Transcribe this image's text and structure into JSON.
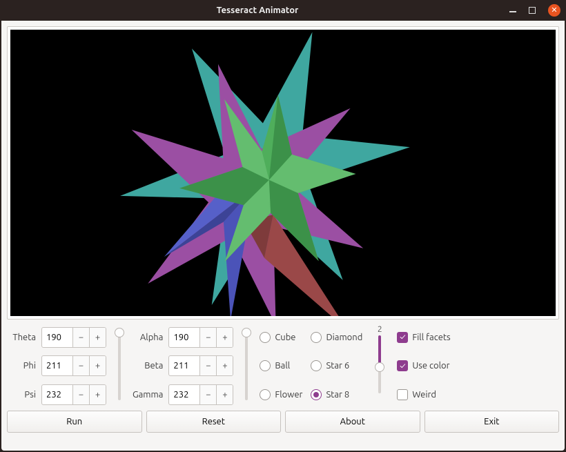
{
  "window": {
    "title": "Tesseract Animator"
  },
  "spinners": {
    "left": [
      {
        "label": "Theta",
        "value": "190"
      },
      {
        "label": "Phi",
        "value": "211"
      },
      {
        "label": "Psi",
        "value": "232"
      }
    ],
    "right": [
      {
        "label": "Alpha",
        "value": "190"
      },
      {
        "label": "Beta",
        "value": "211"
      },
      {
        "label": "Gamma",
        "value": "232"
      }
    ]
  },
  "sliders": {
    "s1": {
      "pos_pct": 2,
      "fill_pct": 2
    },
    "s2": {
      "pos_pct": 2,
      "fill_pct": 2
    },
    "s3": {
      "value": "2",
      "pos_pct": 55,
      "fill_pct": 55
    }
  },
  "shapes": [
    {
      "label": "Cube",
      "selected": false
    },
    {
      "label": "Diamond",
      "selected": false
    },
    {
      "label": "Ball",
      "selected": false
    },
    {
      "label": "Star 6",
      "selected": false
    },
    {
      "label": "Flower",
      "selected": false
    },
    {
      "label": "Star 8",
      "selected": true
    }
  ],
  "checks": [
    {
      "label": "Fill facets",
      "selected": true
    },
    {
      "label": "Use color",
      "selected": true
    },
    {
      "label": "Weird",
      "selected": false
    }
  ],
  "buttons": {
    "run": "Run",
    "reset": "Reset",
    "about": "About",
    "exit": "Exit"
  },
  "glyphs": {
    "minus": "−",
    "plus": "+",
    "check": "✓",
    "close": "✕"
  },
  "colors": {
    "accent": "#8e3c8e",
    "close_btn": "#e95420"
  }
}
